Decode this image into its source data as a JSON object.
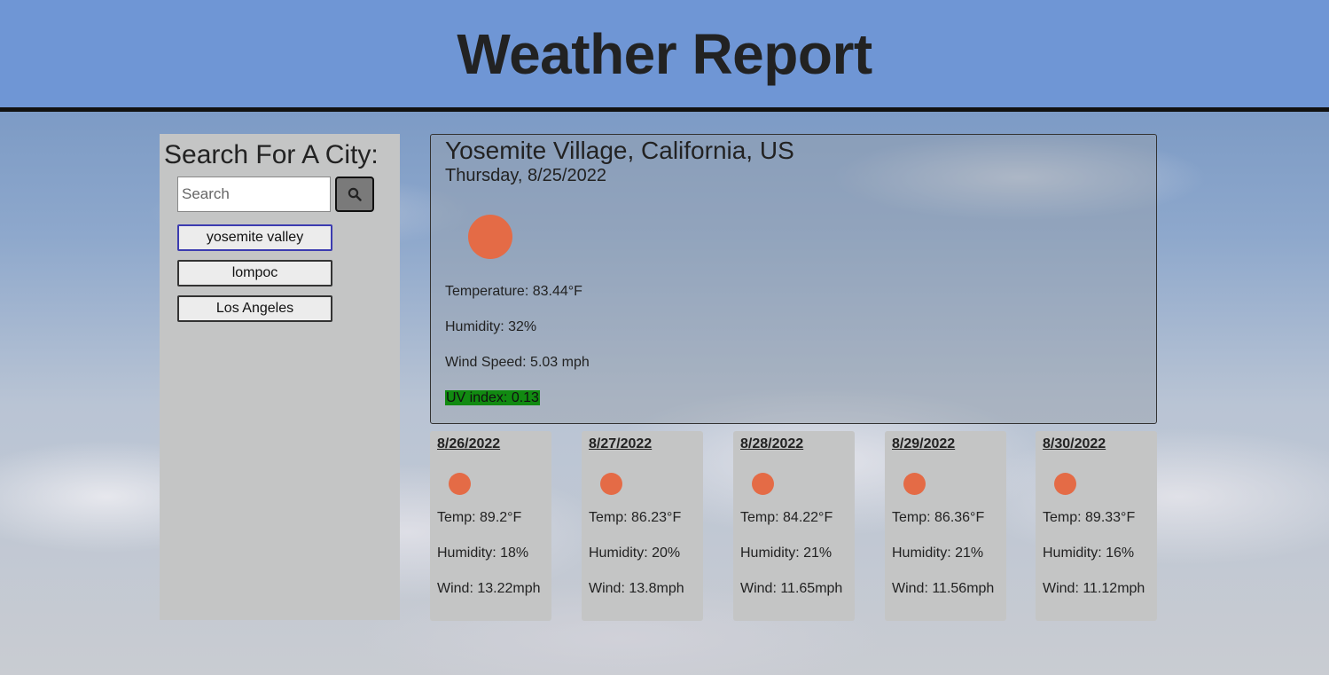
{
  "header": {
    "title": "Weather Report"
  },
  "sidebar": {
    "heading": "Search For A City:",
    "search": {
      "placeholder": "Search",
      "value": ""
    },
    "search_button_icon": "search-icon",
    "history": [
      {
        "label": "yosemite valley",
        "active": true
      },
      {
        "label": "lompoc",
        "active": false
      },
      {
        "label": "Los Angeles",
        "active": false
      }
    ]
  },
  "current": {
    "location": "Yosemite Village, California, US",
    "date": "Thursday, 8/25/2022",
    "icon": "sun-icon",
    "temperature": "Temperature: 83.44°F",
    "humidity": "Humidity: 32%",
    "wind": "Wind Speed: 5.03 mph",
    "uv": "UV index: 0.13",
    "uv_color": "#118a11"
  },
  "forecast": [
    {
      "date": "8/26/2022",
      "icon": "sun-icon",
      "temp": "Temp: 89.2°F",
      "humidity": "Humidity: 18%",
      "wind": "Wind: 13.22mph"
    },
    {
      "date": "8/27/2022",
      "icon": "sun-icon",
      "temp": "Temp: 86.23°F",
      "humidity": "Humidity: 20%",
      "wind": "Wind: 13.8mph"
    },
    {
      "date": "8/28/2022",
      "icon": "sun-icon",
      "temp": "Temp: 84.22°F",
      "humidity": "Humidity: 21%",
      "wind": "Wind: 11.65mph"
    },
    {
      "date": "8/29/2022",
      "icon": "sun-icon",
      "temp": "Temp: 86.36°F",
      "humidity": "Humidity: 21%",
      "wind": "Wind: 11.56mph"
    },
    {
      "date": "8/30/2022",
      "icon": "sun-icon",
      "temp": "Temp: 89.33°F",
      "humidity": "Humidity: 16%",
      "wind": "Wind: 11.12mph"
    }
  ],
  "colors": {
    "header_bg": "#6f96d5",
    "sun": "#e46b46",
    "panel_bg": "#c4c5c5"
  }
}
